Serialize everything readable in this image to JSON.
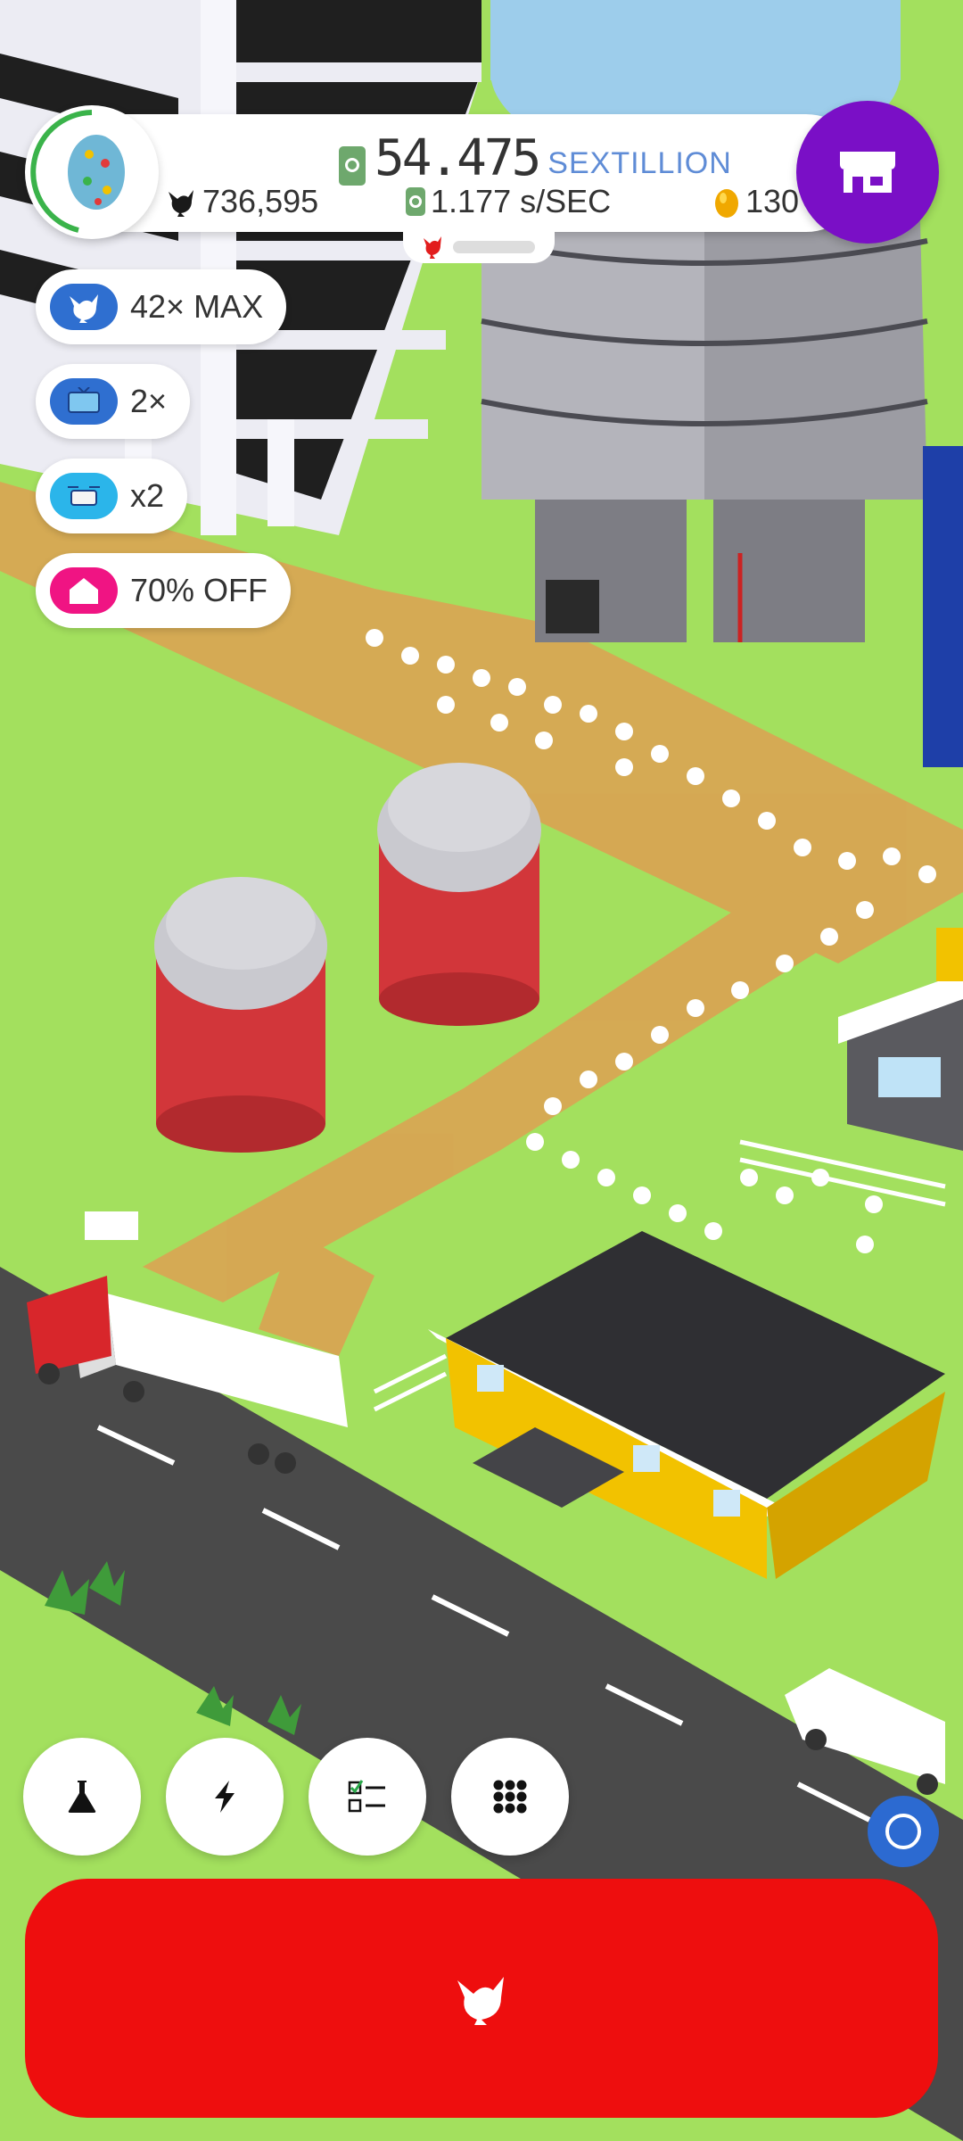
{
  "hud": {
    "money_value": "54.475",
    "money_unit": "SEXTILLION",
    "chicken_count": "736,595",
    "rate_value": "1.177 s/SEC",
    "golden_eggs": "130"
  },
  "boosts": [
    {
      "label": "42× MAX",
      "icon": "chicken-icon",
      "color": "#2f6fd0"
    },
    {
      "label": "2×",
      "icon": "tv-icon",
      "color": "#2f6fd0"
    },
    {
      "label": "x2",
      "icon": "drone-icon",
      "color": "#2bb5ea"
    },
    {
      "label": "70% OFF",
      "icon": "home-icon",
      "color": "#f01483"
    }
  ],
  "bottom_buttons": [
    {
      "icon": "flask-icon"
    },
    {
      "icon": "lightning-icon"
    },
    {
      "icon": "checklist-icon"
    },
    {
      "icon": "grid-icon"
    }
  ],
  "colors": {
    "grass": "#a3e05e",
    "shop": "#7a0fc6",
    "hatch_button": "#ee0e0e",
    "road": "#4a4a4a",
    "money_unit": "#5f8cd6"
  }
}
